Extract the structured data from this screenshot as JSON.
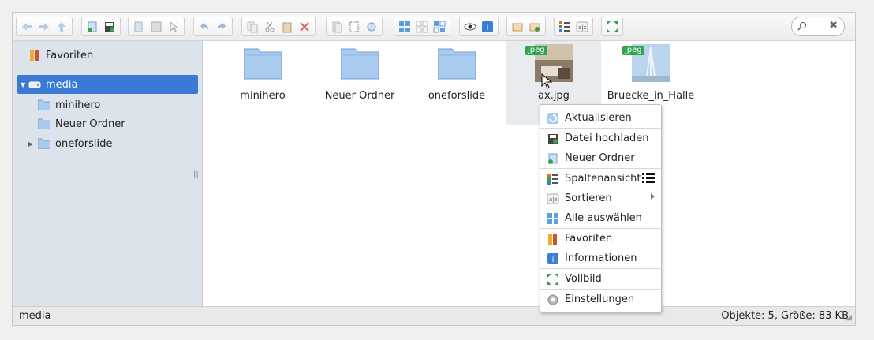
{
  "sidebar": {
    "items": [
      {
        "label": "Favoriten"
      },
      {
        "label": "media"
      },
      {
        "label": "minihero"
      },
      {
        "label": "Neuer Ordner"
      },
      {
        "label": "oneforslide"
      }
    ]
  },
  "files": [
    {
      "name": "minihero",
      "type": "folder"
    },
    {
      "name": "Neuer Ordner",
      "type": "folder"
    },
    {
      "name": "oneforslide",
      "type": "folder"
    },
    {
      "name": "ax.jpg",
      "type": "image",
      "badge": "jpeg"
    },
    {
      "name": "Bruecke_in_Halle",
      "type": "image",
      "badge": "jpeg"
    }
  ],
  "context_menu": {
    "items": [
      {
        "label": "Aktualisieren"
      },
      {
        "label": "Datei hochladen"
      },
      {
        "label": "Neuer Ordner"
      },
      {
        "label": "Spaltenansicht"
      },
      {
        "label": "Sortieren"
      },
      {
        "label": "Alle auswählen"
      },
      {
        "label": "Favoriten"
      },
      {
        "label": "Informationen"
      },
      {
        "label": "Vollbild"
      },
      {
        "label": "Einstellungen"
      }
    ]
  },
  "status": {
    "path": "media",
    "info": "Objekte: 5, Größe: 83 KB"
  },
  "colors": {
    "accent": "#3a79d6",
    "badge": "#2ea44f",
    "folder": "#a9cbee"
  }
}
